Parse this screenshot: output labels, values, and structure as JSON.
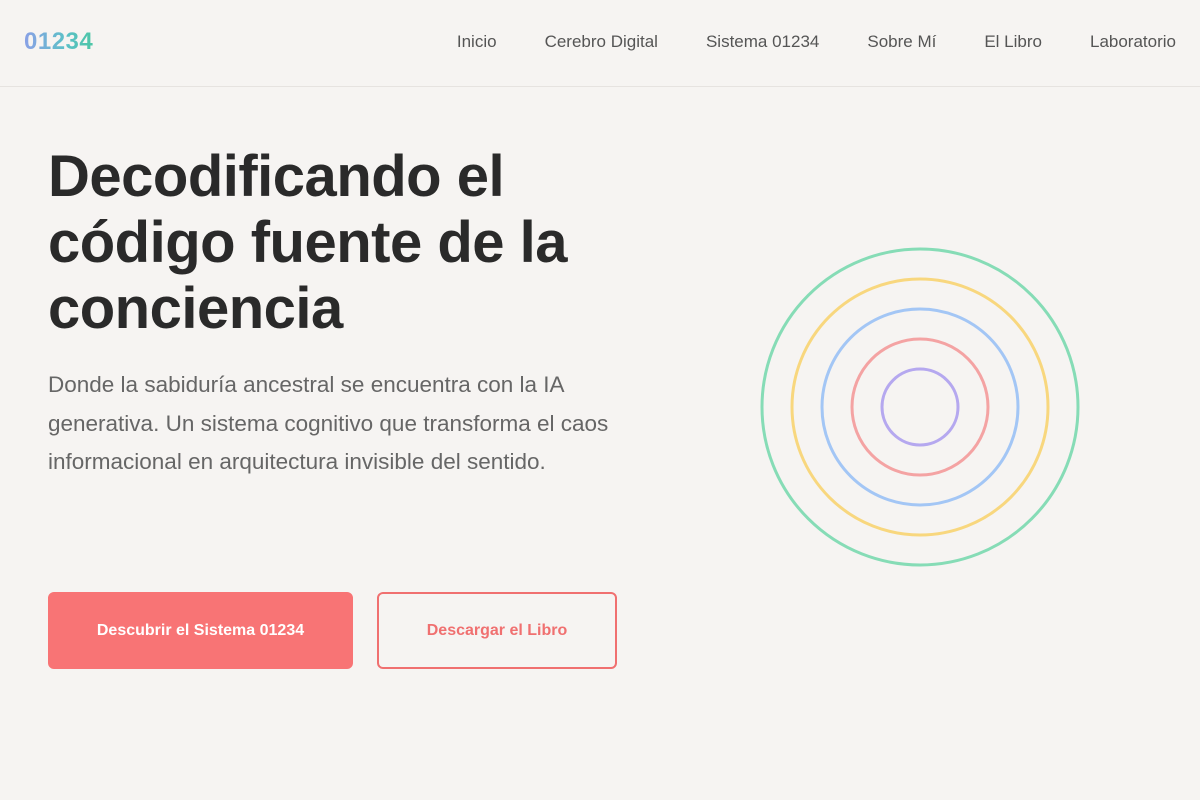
{
  "header": {
    "logo": "01234",
    "nav": [
      {
        "label": "Inicio"
      },
      {
        "label": "Cerebro Digital"
      },
      {
        "label": "Sistema 01234"
      },
      {
        "label": "Sobre Mí"
      },
      {
        "label": "El Libro"
      },
      {
        "label": "Laboratorio"
      }
    ]
  },
  "hero": {
    "title": "Decodificando el código fuente de la conciencia",
    "subtitle": "Donde la sabiduría ancestral se encuentra con la IA generativa. Un sistema cognitivo que transforma el caos informacional en arquitectura invisible del sentido.",
    "primary_button": "Descubrir el Sistema 01234",
    "secondary_button": "Descargar el Libro"
  },
  "illustration": {
    "icon": "concentric-rings-icon",
    "ring_colors": [
      "#86dcb6",
      "#f8d77e",
      "#a3c6f5",
      "#f4a3a3",
      "#b5a8ef"
    ]
  },
  "colors": {
    "accent": "#f87475",
    "background": "#f6f4f2",
    "text": "#2a2a2a",
    "muted": "#666666"
  }
}
